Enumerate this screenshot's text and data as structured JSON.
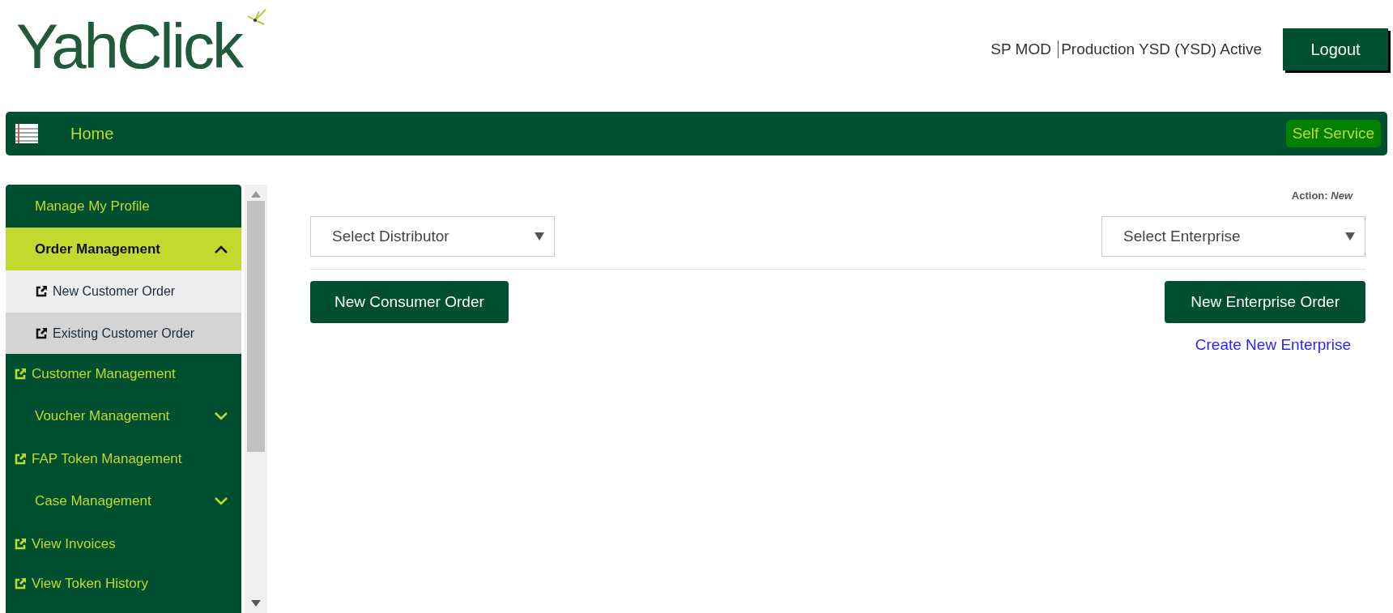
{
  "header": {
    "logo": "YahClick",
    "user": "SP MOD",
    "account": "Production YSD (YSD) Active",
    "logout": "Logout"
  },
  "navbar": {
    "home": "Home",
    "self_service": "Self Service"
  },
  "sidebar": {
    "items": [
      {
        "kind": "plain",
        "label": "Manage My Profile"
      },
      {
        "kind": "group",
        "label": "Order Management",
        "expanded": true,
        "children": [
          {
            "label": "New Customer Order",
            "selected": false
          },
          {
            "label": "Existing Customer Order",
            "selected": true
          }
        ]
      },
      {
        "kind": "link",
        "label": "Customer Management"
      },
      {
        "kind": "group",
        "label": "Voucher Management",
        "expanded": false
      },
      {
        "kind": "link",
        "label": "FAP Token Management"
      },
      {
        "kind": "group",
        "label": "Case Management",
        "expanded": false
      },
      {
        "kind": "link",
        "label": "View Invoices"
      },
      {
        "kind": "link",
        "label": "View Token History"
      }
    ]
  },
  "content": {
    "action_label": "Action:",
    "action_value": "New",
    "distributor_select": {
      "placeholder": "Select Distributor"
    },
    "enterprise_select": {
      "placeholder": "Select Enterprise"
    },
    "consumer_button": "New Consumer Order",
    "enterprise_button": "New Enterprise Order",
    "create_link": "Create New Enterprise"
  }
}
